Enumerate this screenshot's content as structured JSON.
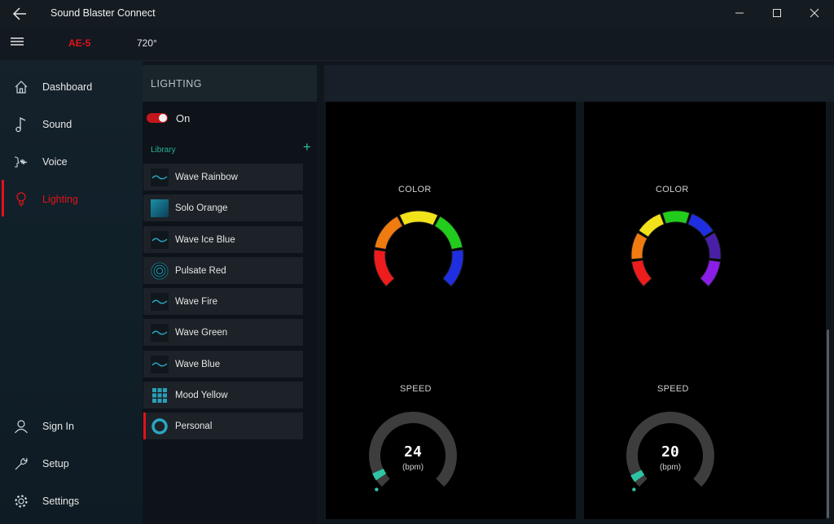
{
  "window": {
    "title": "Sound Blaster Connect"
  },
  "device": {
    "name": "AE-5",
    "mode": "720°"
  },
  "nav": {
    "items": [
      {
        "key": "dashboard",
        "label": "Dashboard",
        "icon": "home-icon"
      },
      {
        "key": "sound",
        "label": "Sound",
        "icon": "music-note-icon"
      },
      {
        "key": "voice",
        "label": "Voice",
        "icon": "voice-icon"
      },
      {
        "key": "lighting",
        "label": "Lighting",
        "icon": "lightbulb-icon",
        "active": true
      }
    ],
    "bottom": [
      {
        "key": "signin",
        "label": "Sign In",
        "icon": "person-icon"
      },
      {
        "key": "setup",
        "label": "Setup",
        "icon": "wrench-icon"
      },
      {
        "key": "settings",
        "label": "Settings",
        "icon": "gear-icon"
      }
    ]
  },
  "lighting": {
    "title": "LIGHTING",
    "toggle_label": "On",
    "toggle_on": true,
    "library_label": "Library",
    "library": [
      {
        "label": "Wave Rainbow",
        "icon": "wave-icon"
      },
      {
        "label": "Solo Orange",
        "icon": "solid-color-icon"
      },
      {
        "label": "Wave Ice Blue",
        "icon": "wave-icon"
      },
      {
        "label": "Pulsate Red",
        "icon": "pulse-icon"
      },
      {
        "label": "Wave Fire",
        "icon": "wave-icon"
      },
      {
        "label": "Wave Green",
        "icon": "wave-icon"
      },
      {
        "label": "Wave Blue",
        "icon": "wave-icon"
      },
      {
        "label": "Mood Yellow",
        "icon": "grid-icon"
      },
      {
        "label": "Personal",
        "icon": "ring-icon",
        "selected": true
      }
    ]
  },
  "zones": [
    {
      "color_label": "COLOR",
      "speed_label": "SPEED",
      "speed_value": "24",
      "speed_unit": "(bpm)",
      "speed_level": 0.06,
      "colors": [
        "#ee1c1c",
        "#f07b10",
        "#f2e21a",
        "#22cc1c",
        "#1f2ee0"
      ]
    },
    {
      "color_label": "COLOR",
      "speed_label": "SPEED",
      "speed_value": "20",
      "speed_unit": "(bpm)",
      "speed_level": 0.05,
      "colors": [
        "#ee1c1c",
        "#f07b10",
        "#f2e21a",
        "#22cc1c",
        "#1f2ee0",
        "#4a1fa8",
        "#8a1ee8"
      ]
    }
  ],
  "colors": {
    "accent": "#e1131a",
    "teal": "#2cc4a6"
  }
}
